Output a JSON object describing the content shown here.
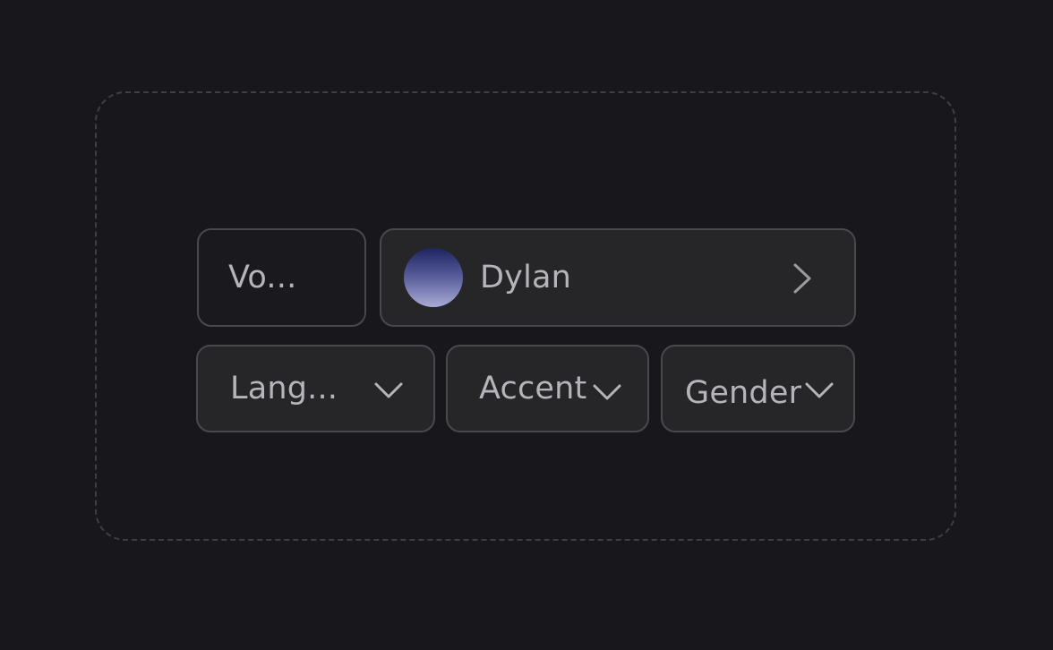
{
  "voice": {
    "label": "Vo...",
    "selected_name": "Dylan",
    "avatar_colors": [
      "#1e2560",
      "#5a5f9c",
      "#a9abd6"
    ]
  },
  "filters": {
    "language": "Lang...",
    "accent": "Accent",
    "gender": "Gender"
  },
  "icons": {
    "voice_select": "chevron-right-icon",
    "dropdown": "chevron-down-icon"
  },
  "colors": {
    "background": "#18181c",
    "field": "#262629",
    "border": "#48484e",
    "text": "#b4b4ba",
    "dashed_border": "#3e3e44"
  }
}
